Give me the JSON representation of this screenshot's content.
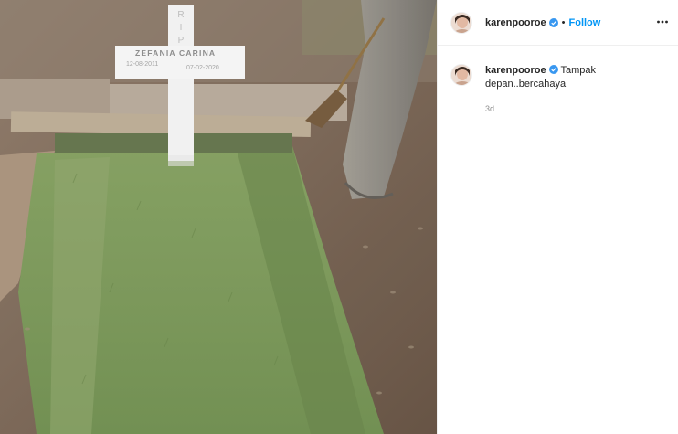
{
  "photo": {
    "cross_name": "ZEFANIA CARINA",
    "cross_date_birth": "12-08-2011",
    "cross_date_death": "07-02-2020",
    "cross_initials": "R I P"
  },
  "header": {
    "avatar_icon": "avatar-icon",
    "username": "karenpooroe",
    "verified_icon": "verified-badge-icon",
    "separator": "•",
    "follow_label": "Follow",
    "more_icon": "more-options-icon"
  },
  "comment": {
    "username": "karenpooroe",
    "text": "Tampak depan..bercahaya",
    "time": "3d"
  },
  "colors": {
    "follow": "#0095f6",
    "verified": "#3897f0",
    "muted": "#8e8e8e"
  }
}
